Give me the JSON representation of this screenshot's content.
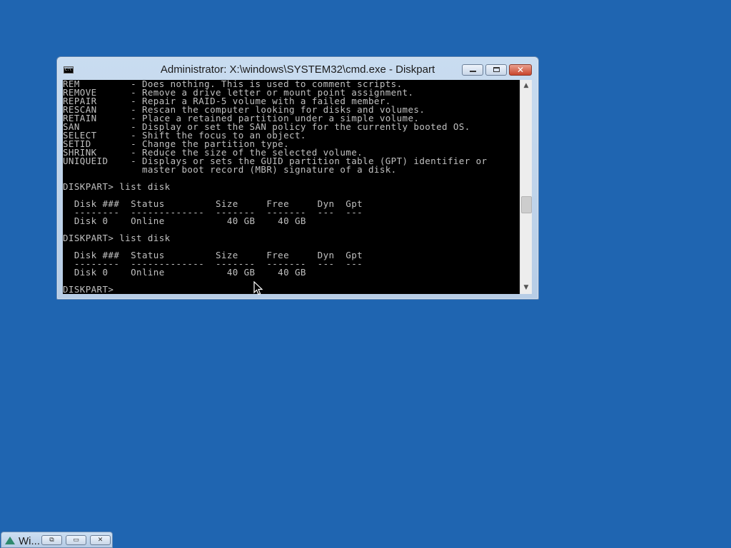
{
  "window": {
    "title": "Administrator: X:\\windows\\SYSTEM32\\cmd.exe - Diskpart",
    "icon": "cmd-icon",
    "minimize_icon": "minimize-icon",
    "maximize_icon": "maximize-icon",
    "close_label": "✕"
  },
  "console": {
    "lines": [
      "REM         - Does nothing. This is used to comment scripts.",
      "REMOVE      - Remove a drive letter or mount point assignment.",
      "REPAIR      - Repair a RAID-5 volume with a failed member.",
      "RESCAN      - Rescan the computer looking for disks and volumes.",
      "RETAIN      - Place a retained partition under a simple volume.",
      "SAN         - Display or set the SAN policy for the currently booted OS.",
      "SELECT      - Shift the focus to an object.",
      "SETID       - Change the partition type.",
      "SHRINK      - Reduce the size of the selected volume.",
      "UNIQUEID    - Displays or sets the GUID partition table (GPT) identifier or",
      "              master boot record (MBR) signature of a disk.",
      "",
      "DISKPART> list disk",
      "",
      "  Disk ###  Status         Size     Free     Dyn  Gpt",
      "  --------  -------------  -------  -------  ---  ---",
      "  Disk 0    Online           40 GB    40 GB",
      "",
      "DISKPART> list disk",
      "",
      "  Disk ###  Status         Size     Free     Dyn  Gpt",
      "  --------  -------------  -------  -------  ---  ---",
      "  Disk 0    Online           40 GB    40 GB",
      "",
      "DISKPART> "
    ]
  },
  "scrollbar": {
    "up_arrow": "▲",
    "down_arrow": "▼",
    "position_fraction": 0.62
  },
  "cursor": {
    "icon": "mouse-pointer-icon"
  },
  "minimized_window": {
    "title": "Wi...",
    "icon": "windows-setup-icon",
    "restore_label": "⧉",
    "maximize_label": "▭",
    "close_label": "✕"
  },
  "colors": {
    "desktop": "#1f65b1",
    "console_bg": "#000000",
    "console_fg": "#c0c0c0",
    "close_button": "#c9452c"
  }
}
